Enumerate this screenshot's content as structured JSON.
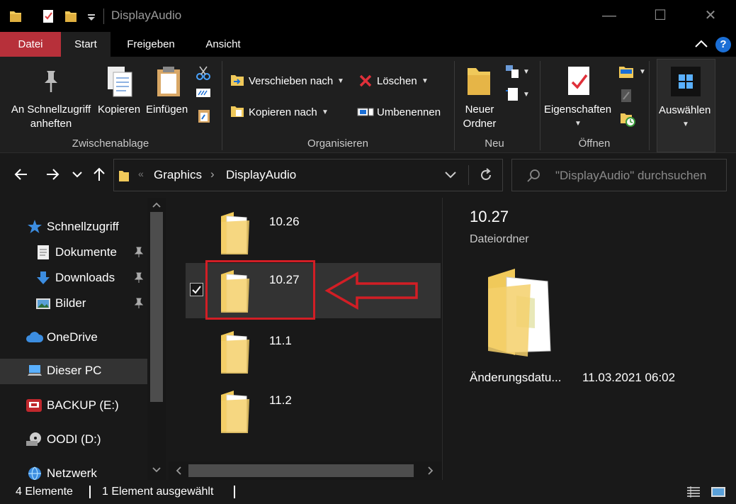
{
  "window": {
    "title": "DisplayAudio",
    "minimize_glyph": "—",
    "maximize_glyph": "☐",
    "close_glyph": "✕"
  },
  "menu_tabs": {
    "datei": "Datei",
    "start": "Start",
    "freigeben": "Freigeben",
    "ansicht": "Ansicht",
    "help": "?"
  },
  "ribbon": {
    "clipboard": {
      "pin_label_1": "An Schnellzugriff",
      "pin_label_2": "anheften",
      "copy_label": "Kopieren",
      "paste_label": "Einfügen",
      "group": "Zwischenablage"
    },
    "organize": {
      "move_to": "Verschieben nach",
      "copy_to": "Kopieren nach",
      "delete": "Löschen",
      "rename": "Umbenennen",
      "group": "Organisieren"
    },
    "new": {
      "new_folder_1": "Neuer",
      "new_folder_2": "Ordner",
      "group": "Neu"
    },
    "open": {
      "properties": "Eigenschaften",
      "group": "Öffnen"
    },
    "select": {
      "select_label": "Auswählen"
    }
  },
  "address": {
    "overflow": "«",
    "breadcrumb": [
      "Graphics",
      "DisplayAudio"
    ],
    "separator": "›",
    "search_placeholder": "\"DisplayAudio\" durchsuchen"
  },
  "nav": {
    "items": [
      {
        "label": "Schnellzugriff",
        "icon": "star-icon"
      },
      {
        "label": "Dokumente",
        "icon": "documents-icon",
        "pinned": true
      },
      {
        "label": "Downloads",
        "icon": "download-arrow-icon",
        "pinned": true
      },
      {
        "label": "Bilder",
        "icon": "pictures-icon",
        "pinned": true
      },
      {
        "label": "OneDrive",
        "icon": "cloud-icon"
      },
      {
        "label": "Dieser PC",
        "icon": "computer-icon",
        "selected": true
      },
      {
        "label": "BACKUP (E:)",
        "icon": "drive-icon"
      },
      {
        "label": "OODI (D:)",
        "icon": "disc-icon"
      },
      {
        "label": "Netzwerk",
        "icon": "network-icon"
      }
    ]
  },
  "files": [
    {
      "name": "10.26",
      "selected": false
    },
    {
      "name": "10.27",
      "selected": true
    },
    {
      "name": "11.1",
      "selected": false
    },
    {
      "name": "11.2",
      "selected": false
    }
  ],
  "preview": {
    "name": "10.27",
    "type": "Dateiordner",
    "date_label": "Änderungsdatu...",
    "date_value": "11.03.2021 06:02"
  },
  "status": {
    "count": "4 Elemente",
    "selected": "1 Element ausgewählt"
  },
  "colors": {
    "accent_red_tab": "#b7303a",
    "folder_yellow": "#f0c95a",
    "annotation_red": "#d21e25",
    "help_blue": "#1b6fd6"
  }
}
